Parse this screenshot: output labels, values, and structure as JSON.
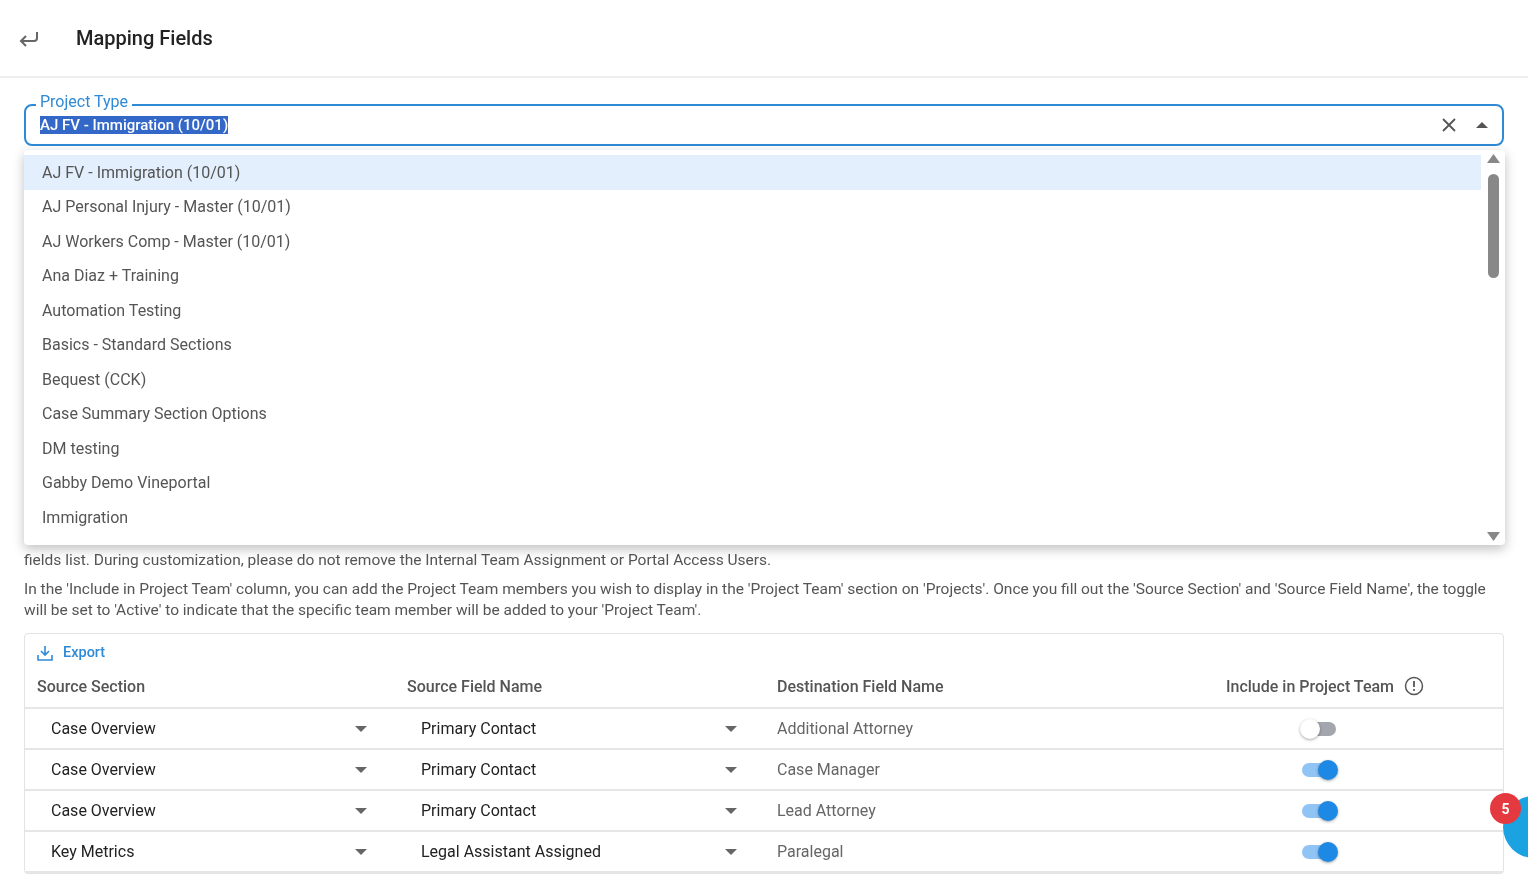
{
  "header": {
    "title": "Mapping Fields"
  },
  "project_type": {
    "label": "Project Type",
    "value": "AJ FV - Immigration (10/01)",
    "expanded": true
  },
  "options": [
    {
      "label": "AJ FV - Immigration (10/01)",
      "selected": true
    },
    {
      "label": "AJ Personal Injury - Master (10/01)",
      "selected": false
    },
    {
      "label": "AJ Workers Comp - Master (10/01)",
      "selected": false
    },
    {
      "label": "Ana Diaz + Training",
      "selected": false
    },
    {
      "label": "Automation Testing",
      "selected": false
    },
    {
      "label": "Basics - Standard Sections",
      "selected": false
    },
    {
      "label": "Bequest (CCK)",
      "selected": false
    },
    {
      "label": "Case Summary Section Options",
      "selected": false
    },
    {
      "label": "DM testing",
      "selected": false
    },
    {
      "label": "Gabby Demo Vineportal",
      "selected": false
    },
    {
      "label": "Immigration",
      "selected": false
    }
  ],
  "paragraphs": [
    "fields list. During customization, please do not remove the Internal Team Assignment or Portal Access Users.",
    "In the 'Include in Project Team' column, you can add the Project Team members you wish to display in the 'Project Team' section on 'Projects'. Once you fill out the 'Source Section' and 'Source Field Name', the toggle will be set to 'Active' to indicate that the specific team member will be added to your 'Project Team'."
  ],
  "table": {
    "export_label": "Export",
    "columns": [
      "Source Section",
      "Source Field Name",
      "Destination Field Name",
      "Include in Project Team"
    ],
    "rows": [
      {
        "source_section": "Case Overview",
        "source_field": "Primary Contact",
        "destination": "Additional Attorney",
        "on": false
      },
      {
        "source_section": "Case Overview",
        "source_field": "Primary Contact",
        "destination": "Case Manager",
        "on": true
      },
      {
        "source_section": "Case Overview",
        "source_field": "Primary Contact",
        "destination": "Lead Attorney",
        "on": true
      },
      {
        "source_section": "Key Metrics",
        "source_field": "Legal Assistant Assigned",
        "destination": "Paralegal",
        "on": true
      }
    ]
  },
  "chat": {
    "badge": "5"
  }
}
